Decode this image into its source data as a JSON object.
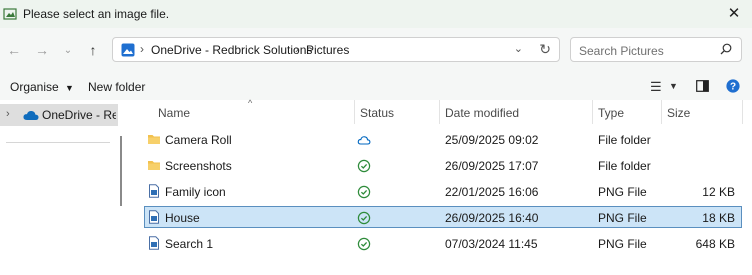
{
  "window": {
    "title": "Please select an image file."
  },
  "address": {
    "segments": [
      "OneDrive - Redbrick Solutions",
      "Pictures"
    ]
  },
  "search": {
    "placeholder": "Search Pictures"
  },
  "toolbar": {
    "organise_label": "Organise",
    "new_folder_label": "New folder"
  },
  "sidebar": {
    "items": [
      {
        "label": "OneDrive - Redbrick Solutions"
      }
    ]
  },
  "columns": {
    "name": "Name",
    "status": "Status",
    "date": "Date modified",
    "type": "Type",
    "size": "Size"
  },
  "files": [
    {
      "name": "Camera Roll",
      "status": "cloud",
      "date": "25/09/2025 09:02",
      "type": "File folder",
      "size": "",
      "icon": "folder-icon",
      "selected": false
    },
    {
      "name": "Screenshots",
      "status": "synced",
      "date": "26/09/2025 17:07",
      "type": "File folder",
      "size": "",
      "icon": "folder-icon",
      "selected": false
    },
    {
      "name": "Family icon",
      "status": "synced",
      "date": "22/01/2025 16:06",
      "type": "PNG File",
      "size": "12 KB",
      "icon": "image-file-icon",
      "selected": false
    },
    {
      "name": "House",
      "status": "synced",
      "date": "26/09/2025 16:40",
      "type": "PNG File",
      "size": "18 KB",
      "icon": "image-file-icon",
      "selected": true
    },
    {
      "name": "Search 1",
      "status": "synced",
      "date": "07/03/2024 11:45",
      "type": "PNG File",
      "size": "648 KB",
      "icon": "image-file-icon",
      "selected": false
    }
  ],
  "colors": {
    "accent": "#0067c0",
    "selection": "#cce4f7",
    "synced": "#2e8b3a",
    "folder": "#f2c14e"
  }
}
